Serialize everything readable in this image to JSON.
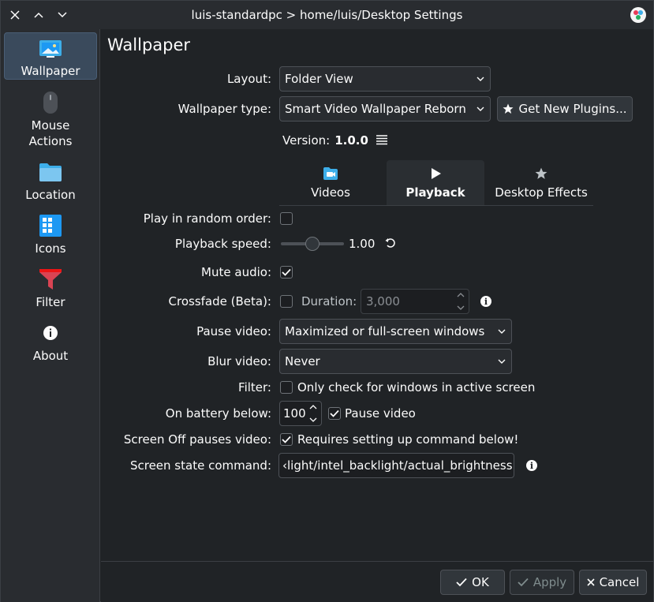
{
  "window": {
    "title": "luis-standardpc > home/luis/Desktop Settings"
  },
  "sidebar": {
    "items": [
      {
        "label": "Wallpaper",
        "icon": "wallpaper-icon",
        "active": true
      },
      {
        "label": "Mouse\nActions",
        "line1": "Mouse",
        "line2": "Actions",
        "icon": "mouse-icon"
      },
      {
        "label": "Location",
        "icon": "folder-icon"
      },
      {
        "label": "Icons",
        "icon": "grid-icon"
      },
      {
        "label": "Filter",
        "icon": "funnel-icon"
      },
      {
        "label": "About",
        "icon": "info-icon"
      }
    ]
  },
  "main": {
    "heading": "Wallpaper",
    "layout": {
      "label": "Layout:",
      "value": "Folder View"
    },
    "wallpaper_type": {
      "label": "Wallpaper type:",
      "value": "Smart Video Wallpaper Reborn",
      "get_plugins": "Get New Plugins..."
    },
    "version": {
      "label": "Version:",
      "value": "1.0.0"
    },
    "tabs": [
      {
        "label": "Videos",
        "icon": "video-folder-icon"
      },
      {
        "label": "Playback",
        "icon": "play-icon",
        "active": true
      },
      {
        "label": "Desktop Effects",
        "icon": "star-icon"
      }
    ],
    "random_order": {
      "label": "Play in random order:",
      "checked": false
    },
    "playback_speed": {
      "label": "Playback speed:",
      "value": "1.00",
      "fraction": 0.5
    },
    "mute_audio": {
      "label": "Mute audio:",
      "checked": true
    },
    "crossfade": {
      "label": "Crossfade (Beta):",
      "checked": false,
      "duration_label": "Duration:",
      "duration_value": "3,000"
    },
    "pause_video": {
      "label": "Pause video:",
      "value": "Maximized or full-screen windows"
    },
    "blur_video": {
      "label": "Blur video:",
      "value": "Never"
    },
    "filter": {
      "label": "Filter:",
      "option": "Only check for windows in active screen",
      "checked": false
    },
    "battery": {
      "label": "On battery below:",
      "value": "100",
      "pause_label": "Pause video",
      "pause_checked": true
    },
    "screen_off": {
      "label": "Screen Off pauses video:",
      "option": "Requires setting up command below!",
      "checked": true
    },
    "screen_cmd": {
      "label": "Screen state command:",
      "value": "‹light/intel_backlight/actual_brightness"
    }
  },
  "footer": {
    "ok": "OK",
    "apply": "Apply",
    "cancel": "Cancel"
  },
  "colors": {
    "background": "#202326",
    "panel": "#292c30",
    "accent": "#3daee9",
    "text": "#fcfcfc",
    "disabled": "#8a8e93"
  }
}
